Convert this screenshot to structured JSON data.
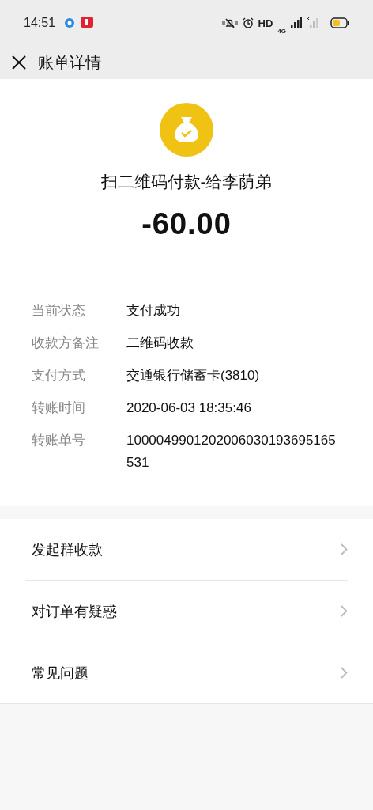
{
  "status_bar": {
    "time": "14:51",
    "hd": "HD",
    "network": "4G"
  },
  "header": {
    "title": "账单详情"
  },
  "summary": {
    "title": "扫二维码付款-给李荫弟",
    "amount": "-60.00"
  },
  "details": [
    {
      "label": "当前状态",
      "value": "支付成功"
    },
    {
      "label": "收款方备注",
      "value": "二维码收款"
    },
    {
      "label": "支付方式",
      "value": "交通银行储蓄卡(3810)"
    },
    {
      "label": "转账时间",
      "value": "2020-06-03 18:35:46"
    },
    {
      "label": "转账单号",
      "value": "1000049901202006030193695165531"
    }
  ],
  "menu": [
    {
      "label": "发起群收款"
    },
    {
      "label": "对订单有疑惑"
    },
    {
      "label": "常见问题"
    }
  ]
}
